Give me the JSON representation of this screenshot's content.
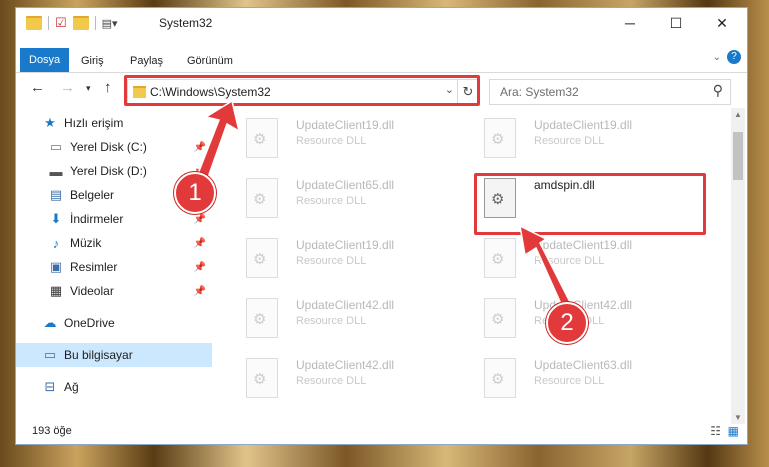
{
  "window": {
    "title": "System32"
  },
  "ribbon": {
    "tabs": [
      {
        "label": "Dosya",
        "active": true
      },
      {
        "label": "Giriş"
      },
      {
        "label": "Paylaş"
      },
      {
        "label": "Görünüm"
      }
    ]
  },
  "address": {
    "path": "C:\\Windows\\System32"
  },
  "search": {
    "placeholder": "Ara: System32"
  },
  "nav": {
    "items": [
      {
        "label": "Hızlı erişim",
        "icon": "star-icon"
      },
      {
        "label": "Yerel Disk (C:)",
        "icon": "drive-icon",
        "pinned": true
      },
      {
        "label": "Yerel Disk (D:)",
        "icon": "drive-icon",
        "pinned": true
      },
      {
        "label": "Belgeler",
        "icon": "document-icon",
        "pinned": true
      },
      {
        "label": "İndirmeler",
        "icon": "download-icon",
        "pinned": true
      },
      {
        "label": "Müzik",
        "icon": "music-icon",
        "pinned": true
      },
      {
        "label": "Resimler",
        "icon": "image-icon",
        "pinned": true
      },
      {
        "label": "Videolar",
        "icon": "video-icon",
        "pinned": true
      },
      {
        "label": "OneDrive",
        "icon": "cloud-icon"
      },
      {
        "label": "Bu bilgisayar",
        "icon": "computer-icon",
        "selected": true
      },
      {
        "label": "Ağ",
        "icon": "network-icon"
      }
    ]
  },
  "files": [
    {
      "name": "UpdateClient19.dll",
      "type": "Resource DLL"
    },
    {
      "name": "UpdateClient19.dll",
      "type": "Resource DLL"
    },
    {
      "name": "UpdateClient65.dll",
      "type": "Resource DLL"
    },
    {
      "name": "amdspin.dll",
      "type": "",
      "highlighted": true
    },
    {
      "name": "UpdateClient19.dll",
      "type": "Resource DLL"
    },
    {
      "name": "UpdateClient19.dll",
      "type": "Resource DLL"
    },
    {
      "name": "UpdateClient42.dll",
      "type": "Resource DLL"
    },
    {
      "name": "UpdateClient42.dll",
      "type": "Resource DLL"
    },
    {
      "name": "UpdateClient42.dll",
      "type": "Resource DLL"
    },
    {
      "name": "UpdateClient63.dll",
      "type": "Resource DLL"
    }
  ],
  "status": {
    "count": "193 öğe"
  },
  "annotations": {
    "step1": "1",
    "step2": "2",
    "color": "#e2393a"
  }
}
